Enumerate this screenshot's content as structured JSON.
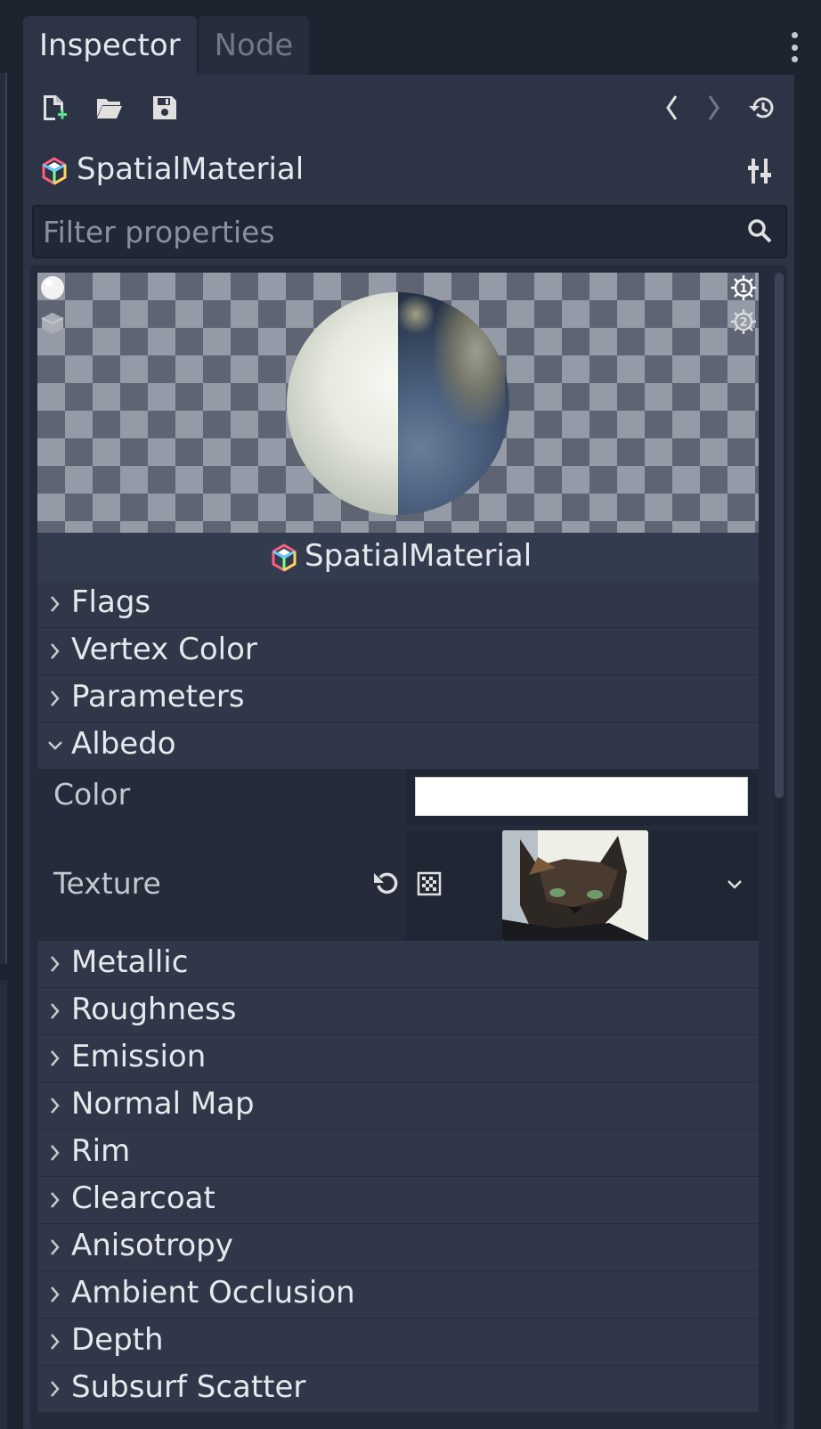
{
  "tabs": [
    {
      "label": "Inspector",
      "active": true
    },
    {
      "label": "Node",
      "active": false
    }
  ],
  "toolbar": {
    "icons": [
      "new-resource-icon",
      "open-folder-icon",
      "save-icon",
      "back-icon",
      "forward-icon",
      "history-icon"
    ]
  },
  "resource": {
    "title": "SpatialMaterial",
    "icon": "material-cube-icon"
  },
  "filter": {
    "placeholder": "Filter properties",
    "value": ""
  },
  "preview": {
    "header": "SpatialMaterial"
  },
  "sections_top": [
    {
      "label": "Flags",
      "expanded": false
    },
    {
      "label": "Vertex Color",
      "expanded": false
    },
    {
      "label": "Parameters",
      "expanded": false
    },
    {
      "label": "Albedo",
      "expanded": true
    }
  ],
  "albedo": {
    "color_label": "Color",
    "color_value": "#ffffff",
    "texture_label": "Texture"
  },
  "sections_bottom": [
    {
      "label": "Metallic"
    },
    {
      "label": "Roughness"
    },
    {
      "label": "Emission"
    },
    {
      "label": "Normal Map"
    },
    {
      "label": "Rim"
    },
    {
      "label": "Clearcoat"
    },
    {
      "label": "Anisotropy"
    },
    {
      "label": "Ambient Occlusion"
    },
    {
      "label": "Depth"
    },
    {
      "label": "Subsurf Scatter"
    }
  ],
  "colors": {
    "panel": "#2c3446",
    "background": "#1e2330",
    "section": "#2f3749",
    "text": "#e6e8ec"
  }
}
